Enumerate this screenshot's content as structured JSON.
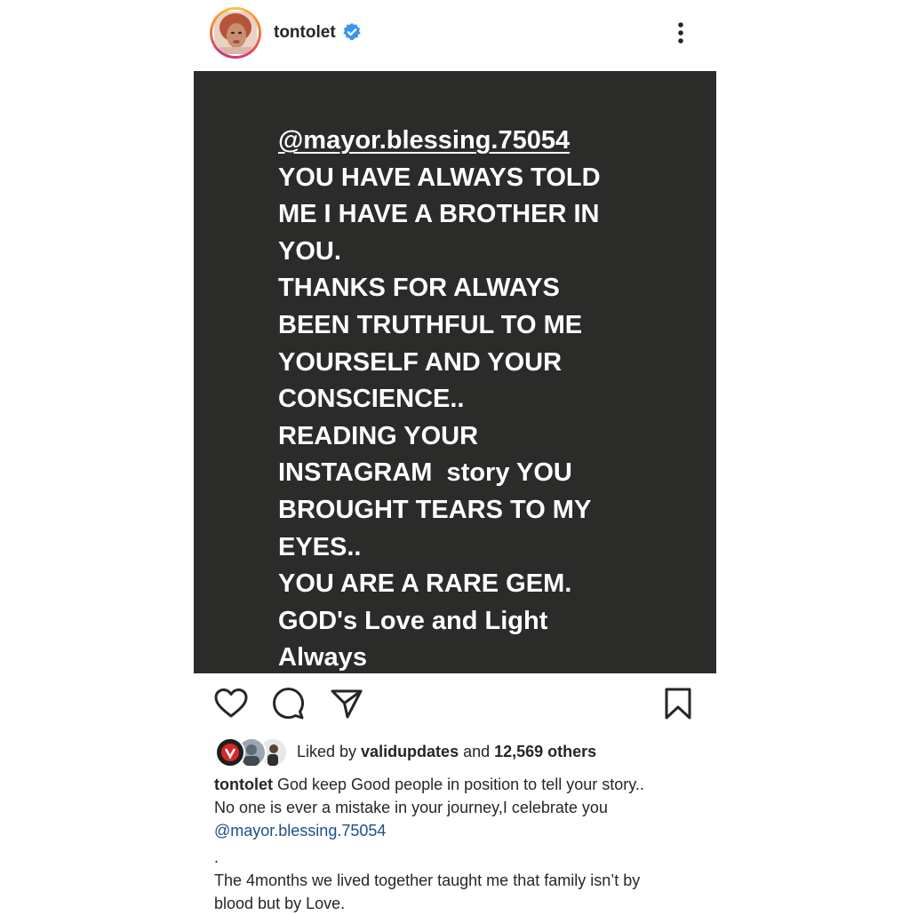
{
  "header": {
    "username": "tontolet",
    "verified": true,
    "avatar_icon": "avatar",
    "more_icon": "more-vertical-icon"
  },
  "photo": {
    "background": "#2b2b2a",
    "lines": [
      "@mayor.blessing.75054",
      "YOU HAVE ALWAYS TOLD",
      "ME I HAVE A BROTHER IN",
      "YOU.",
      "THANKS FOR ALWAYS",
      "BEEN TRUTHFUL TO ME",
      "YOURSELF AND YOUR",
      "CONSCIENCE..",
      "READING YOUR",
      "INSTAGRAM  story YOU",
      "BROUGHT TEARS TO MY",
      "EYES..",
      "YOU ARE A RARE GEM.",
      "GOD's Love and Light",
      "Always"
    ]
  },
  "actions": {
    "like": "heart-icon",
    "comment": "comment-icon",
    "share": "send-icon",
    "save": "bookmark-icon"
  },
  "likes": {
    "prefix": "Liked by ",
    "user": "validupdates",
    "middle": " and ",
    "count": "12,569 others"
  },
  "caption": {
    "username": "tontolet",
    "text_line1": " God keep Good people in position to tell your story..",
    "text_line2": "No one is ever a mistake in your journey,I celebrate you",
    "mention": "@mayor.blessing.75054",
    "dot": ".",
    "text_line3": "The 4months we lived together taught me that family isn’t by",
    "text_line4": "blood but by Love."
  }
}
